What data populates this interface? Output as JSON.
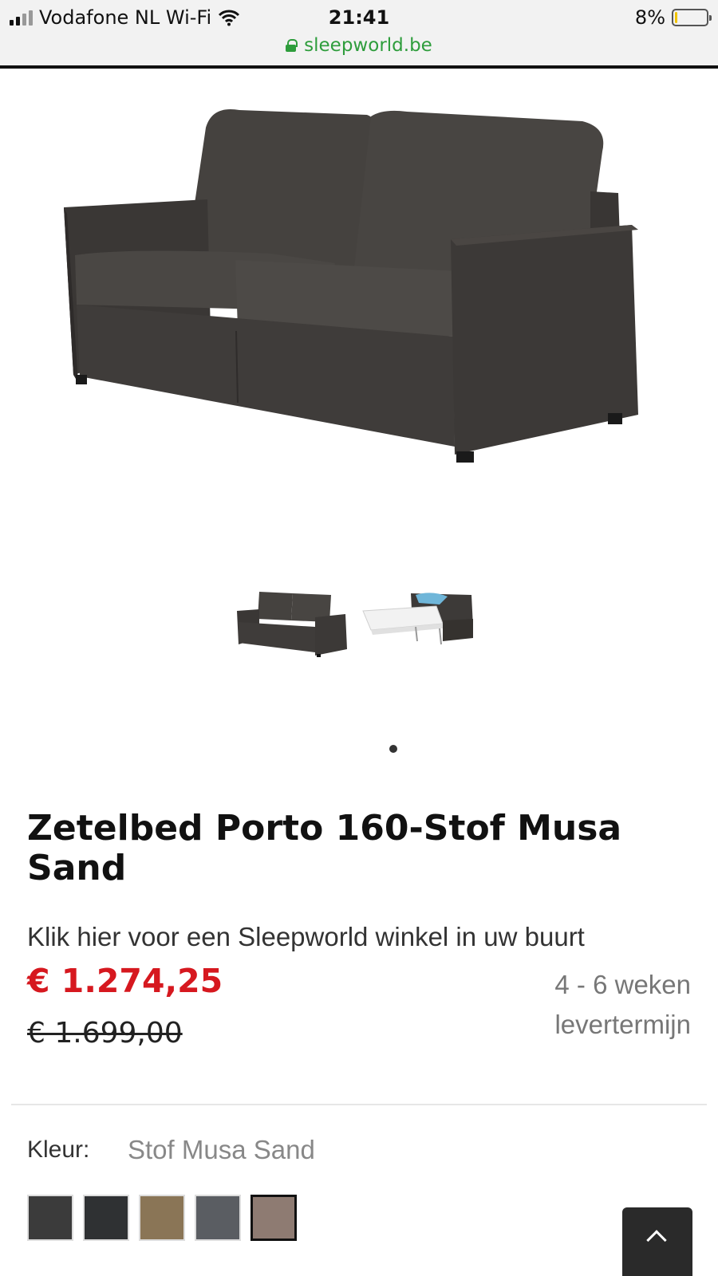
{
  "status_bar": {
    "carrier": "Vodafone NL Wi-Fi",
    "time": "21:41",
    "battery": "8%",
    "battery_level": 0.08,
    "url": "sleepworld.be",
    "icons": [
      "signal-icon",
      "wifi-icon",
      "battery-icon",
      "lock-icon"
    ]
  },
  "product": {
    "title": "Zetelbed Porto 160-Stof Musa Sand",
    "store_link": "Klik hier voor een Sleepworld winkel in uw buurt",
    "price": "€ 1.274,25",
    "old_price": "€ 1.699,00",
    "delivery": "4 - 6 weken levertermijn"
  },
  "gallery": {
    "thumbnail_count": 2,
    "active_dot": 1
  },
  "color": {
    "label": "Kleur:",
    "value": "Stof Musa Sand",
    "swatches": [
      "#3b3b3b",
      "#2f3133",
      "#8a7556",
      "#5a5d62",
      "#8e7b72"
    ],
    "selected_index": 4
  },
  "colors": {
    "price_red": "#d6181f",
    "url_green": "#2e9d3c",
    "sofa": "#3d3a38"
  }
}
